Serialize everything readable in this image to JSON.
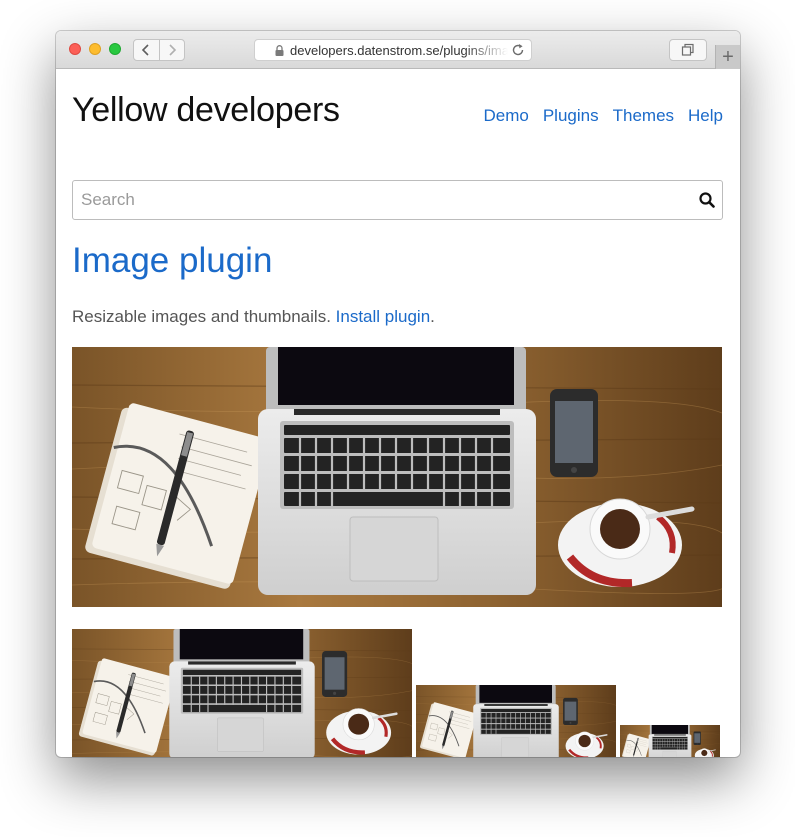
{
  "browser": {
    "url": "developers.datenstrom.se/plugins/image"
  },
  "site": {
    "title": "Yellow developers",
    "nav": [
      "Demo",
      "Plugins",
      "Themes",
      "Help"
    ]
  },
  "search": {
    "placeholder": "Search"
  },
  "page": {
    "heading": "Image plugin",
    "intro_text": "Resizable images and thumbnails. ",
    "intro_link": "Install plugin",
    "intro_end": "."
  },
  "images": {
    "main_alt": "Laptop, notebook, phone and coffee cup on a wooden desk",
    "thumb_alt": "Laptop on a wooden desk thumbnail"
  },
  "colors": {
    "link": "#1b6ac9",
    "title": "#111111",
    "text": "#555555",
    "wood": "#8b6434"
  }
}
